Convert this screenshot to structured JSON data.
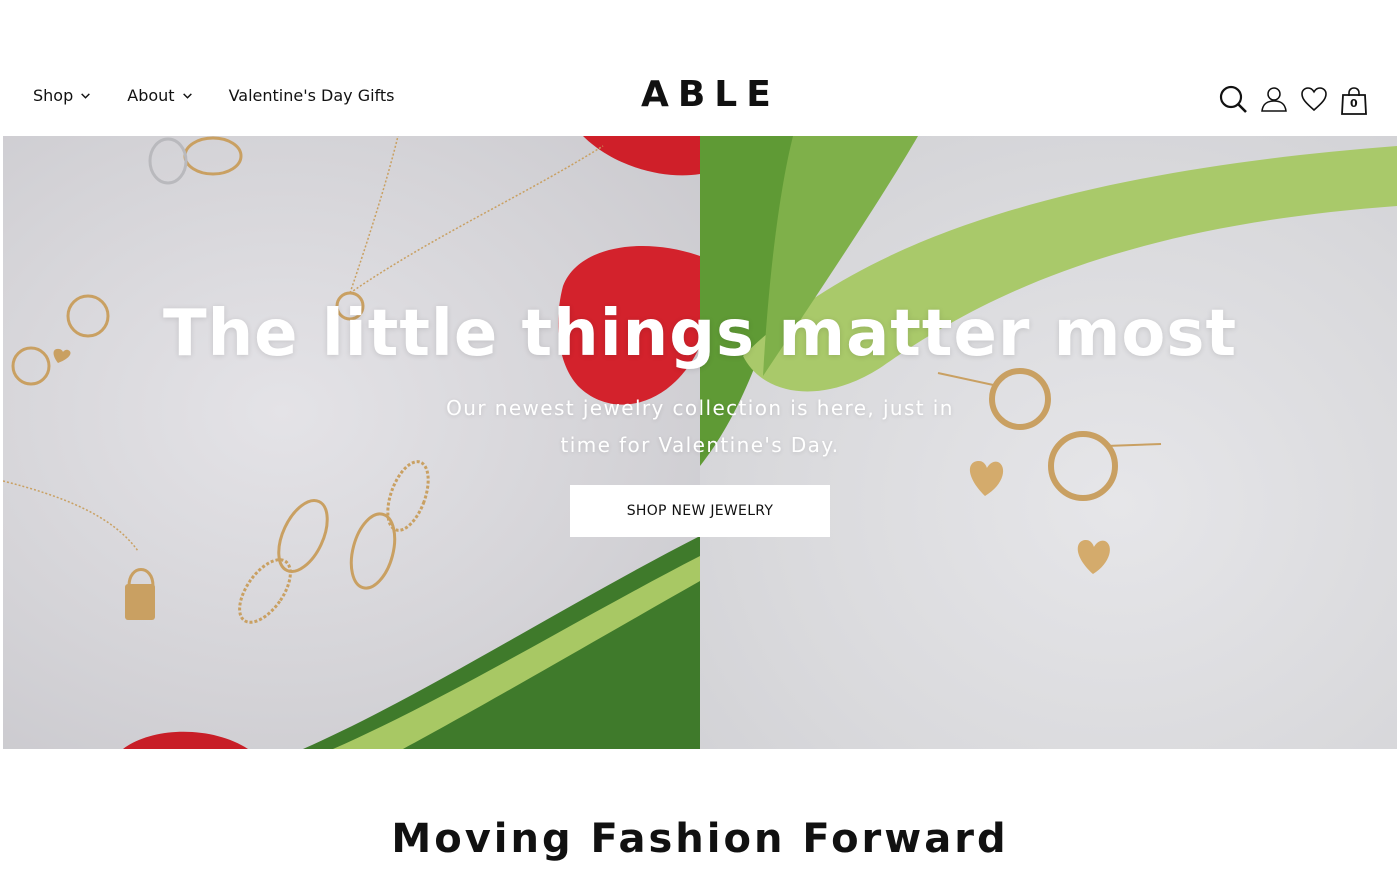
{
  "header": {
    "nav": [
      {
        "label": "Shop",
        "has_dropdown": true
      },
      {
        "label": "About",
        "has_dropdown": true
      },
      {
        "label": "Valentine's Day Gifts",
        "has_dropdown": false
      }
    ],
    "logo": "ABLE",
    "icons": [
      "search-icon",
      "account-icon",
      "wishlist-heart-icon",
      "cart-bag-icon"
    ],
    "cart_count": "0"
  },
  "hero": {
    "title": "The little things matter most",
    "subtitle": "Our newest jewelry collection is here, just in time for Valentine's Day.",
    "cta_label": "SHOP NEW JEWELRY"
  },
  "section": {
    "title": "Moving Fashion Forward"
  },
  "colors": {
    "text": "#111111",
    "background": "#ffffff",
    "hero_text": "#ffffff",
    "petal_red": "#d3222c",
    "leaf_green": "#6fa63c",
    "gold": "#c9a062"
  }
}
